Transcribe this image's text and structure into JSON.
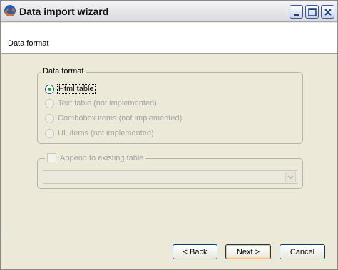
{
  "window": {
    "title": "Data import wizard",
    "controls": [
      "minimize",
      "maximize",
      "close"
    ]
  },
  "header": {
    "title": "Data format"
  },
  "format_group": {
    "legend": "Data format",
    "options": [
      {
        "label": "Html table",
        "checked": true,
        "enabled": true
      },
      {
        "label": "Text table (not implemented)",
        "checked": false,
        "enabled": false
      },
      {
        "label": "Combobox items (not implemented)",
        "checked": false,
        "enabled": false
      },
      {
        "label": "UL items (not implemented)",
        "checked": false,
        "enabled": false
      }
    ]
  },
  "append_group": {
    "label": "Append to existing table",
    "checked": false,
    "enabled": false,
    "select_value": ""
  },
  "buttons": {
    "back": "< Back",
    "next": "Next >",
    "cancel": "Cancel"
  },
  "colors": {
    "dialog_bg": "#ece9d8",
    "radio_checked": "#21a121",
    "disabled_text": "#a5a5a5",
    "button_border": "#003c74"
  }
}
